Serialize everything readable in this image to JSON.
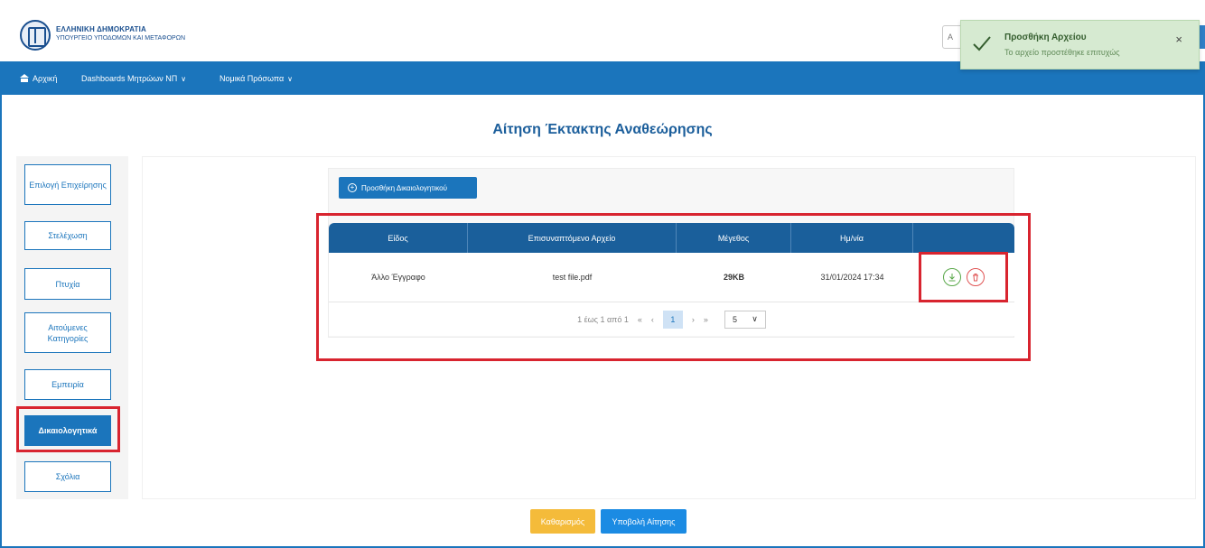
{
  "header": {
    "org_line1": "ΕΛΛΗΝΙΚΗ ΔΗΜΟΚΡΑΤΙΑ",
    "org_line2": "ΥΠΟΥΡΓΕΙΟ ΥΠΟΔΟΜΩΝ ΚΑΙ ΜΕΤΑΦΟΡΩΝ",
    "search_stub_text": "Α"
  },
  "toast": {
    "title": "Προσθήκη Αρχείου",
    "message": "Το αρχείο προστέθηκε επιτυχώς",
    "close_glyph": "×",
    "color": "#d6ead1"
  },
  "nav": {
    "home": "Αρχική",
    "dashboards": "Dashboards Μητρώων ΝΠ",
    "legal_entities": "Νομικά Πρόσωπα",
    "chevron": "∨"
  },
  "page": {
    "title": "Αίτηση Έκτακτης Αναθεώρησης"
  },
  "sidebar": {
    "items": [
      {
        "label": "Επιλογή Επιχείρησης"
      },
      {
        "label": "Στελέχωση"
      },
      {
        "label": "Πτυχία"
      },
      {
        "label": "Αιτούμενες Κατηγορίες"
      },
      {
        "label": "Εμπειρία"
      },
      {
        "label": "Δικαιολογητικά",
        "active": true
      },
      {
        "label": "Σχόλια"
      }
    ]
  },
  "documents": {
    "add_button": "Προσθήκη Δικαιολογητικού",
    "columns": [
      "Είδος",
      "Επισυναπτόμενο Αρχείο",
      "Μέγεθος",
      "Ημ/νία",
      ""
    ],
    "rows": [
      {
        "type": "Άλλο Έγγραφο",
        "file": "test file.pdf",
        "size": "29KB",
        "date": "31/01/2024 17:34"
      }
    ],
    "pagination": {
      "summary": "1 έως 1 από 1",
      "first": "«",
      "prev": "‹",
      "current": "1",
      "next": "›",
      "last": "»",
      "page_size": "5"
    }
  },
  "actions": {
    "clear": "Καθαρισμός",
    "submit": "Υποβολή Αίτησης"
  },
  "colors": {
    "primary": "#1b75bc",
    "table_header": "#1a5f9b",
    "highlight": "#d8242f",
    "warning": "#f4bb3a"
  },
  "icons": [
    "bank-icon",
    "check-icon",
    "close-icon",
    "plus-circle-icon",
    "download-icon",
    "trash-icon",
    "chevron-down-icon"
  ]
}
